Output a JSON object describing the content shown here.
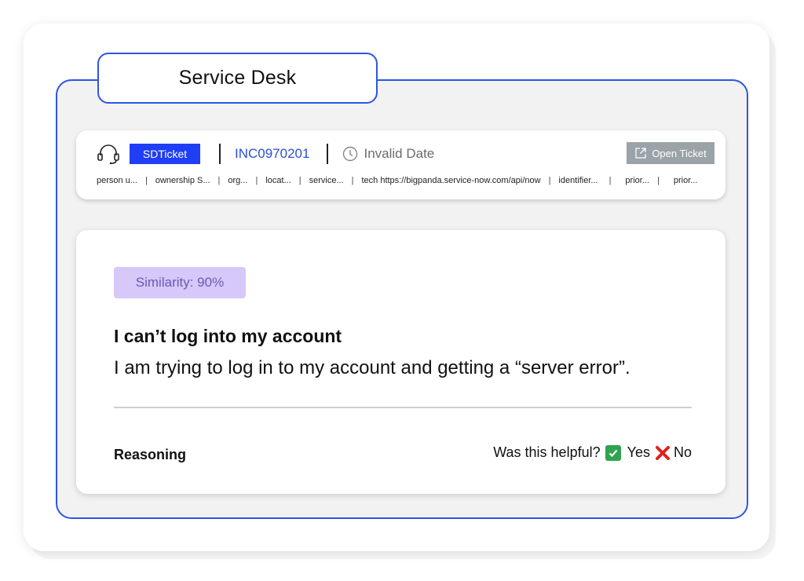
{
  "title": "Service Desk",
  "ticket": {
    "type_badge": "SDTicket",
    "id": "INC0970201",
    "date": "Invalid Date",
    "open_button": "Open Ticket",
    "fields": [
      "person u...",
      "ownership S...",
      "org...",
      "locat...",
      "service...",
      "tech https://bigpanda.service-now.com/api/now",
      "identifier...",
      "prior...",
      "prior..."
    ]
  },
  "result": {
    "similarity": "Similarity: 90%",
    "issue_title": "I can’t log into my account",
    "issue_description": "I am trying to log in to my account and getting a “server error”.",
    "reasoning_label": "Reasoning",
    "helpful_prompt": "Was this helpful?",
    "yes_label": "Yes",
    "no_label": "No"
  },
  "colors": {
    "accent": "#2d55e6",
    "badge_blue": "#1f3ef5",
    "similarity_bg": "#d6c8f8",
    "similarity_text": "#6c58b5",
    "open_button_bg": "#9aa3a8",
    "yes_green": "#2ea44f",
    "no_red": "#e0201b"
  },
  "icons": [
    "headset-icon",
    "clock-icon",
    "external-link-icon",
    "check-icon",
    "x-icon"
  ]
}
